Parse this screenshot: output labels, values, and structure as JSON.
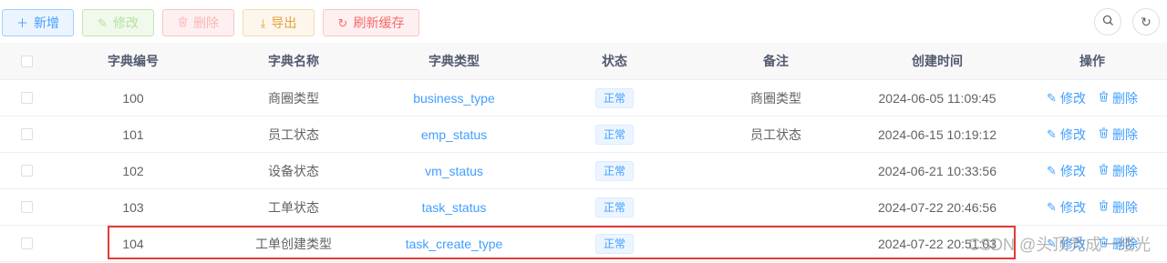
{
  "toolbar": {
    "add": {
      "icon": "plus-icon",
      "label": "新增"
    },
    "edit": {
      "icon": "edit-icon",
      "label": "修改"
    },
    "delete": {
      "icon": "trash-icon",
      "label": "删除"
    },
    "export": {
      "icon": "download-icon",
      "label": "导出"
    },
    "refresh_cache": {
      "icon": "refresh-icon",
      "label": "刷新缓存"
    }
  },
  "table": {
    "headers": [
      "字典编号",
      "字典名称",
      "字典类型",
      "状态",
      "备注",
      "创建时间",
      "操作"
    ],
    "rows": [
      {
        "code": "100",
        "name": "商圈类型",
        "type": "business_type",
        "status": "正常",
        "remark": "商圈类型",
        "created": "2024-06-05 11:09:45",
        "edit": "修改",
        "delete": "删除"
      },
      {
        "code": "101",
        "name": "员工状态",
        "type": "emp_status",
        "status": "正常",
        "remark": "员工状态",
        "created": "2024-06-15 10:19:12",
        "edit": "修改",
        "delete": "删除"
      },
      {
        "code": "102",
        "name": "设备状态",
        "type": "vm_status",
        "status": "正常",
        "remark": "",
        "created": "2024-06-21 10:33:56",
        "edit": "修改",
        "delete": "删除"
      },
      {
        "code": "103",
        "name": "工单状态",
        "type": "task_status",
        "status": "正常",
        "remark": "",
        "created": "2024-07-22 20:46:56",
        "edit": "修改",
        "delete": "删除"
      },
      {
        "code": "104",
        "name": "工单创建类型",
        "type": "task_create_type",
        "status": "正常",
        "remark": "",
        "created": "2024-07-22 20:51:03",
        "edit": "修改",
        "delete": "删除"
      }
    ]
  },
  "watermark": "CSDN @头顶秃成一缕光",
  "colors": {
    "primary": "#409eff",
    "success": "#67c23a",
    "warning": "#e6a23c",
    "danger": "#f56c6c",
    "highlight": "#e53935"
  }
}
